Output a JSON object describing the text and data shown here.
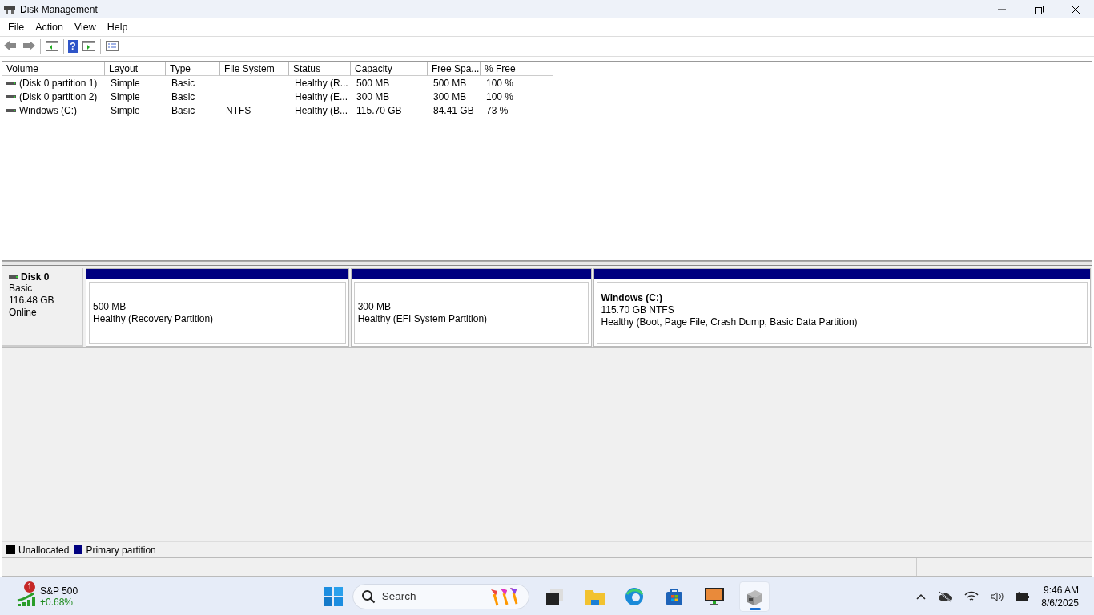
{
  "window": {
    "title": "Disk Management"
  },
  "menu": [
    "File",
    "Action",
    "View",
    "Help"
  ],
  "toolbar": [
    {
      "kind": "back"
    },
    {
      "kind": "forward"
    },
    {
      "kind": "sep"
    },
    {
      "kind": "pane"
    },
    {
      "kind": "sep"
    },
    {
      "kind": "help",
      "label": "?"
    },
    {
      "kind": "pane2"
    },
    {
      "kind": "sep"
    },
    {
      "kind": "props"
    }
  ],
  "table": {
    "columns": [
      "Volume",
      "Layout",
      "Type",
      "File System",
      "Status",
      "Capacity",
      "Free Spa...",
      "% Free"
    ],
    "rows": [
      [
        "(Disk 0 partition 1)",
        "Simple",
        "Basic",
        "",
        "Healthy (R...",
        "500 MB",
        "500 MB",
        "100 %"
      ],
      [
        "(Disk 0 partition 2)",
        "Simple",
        "Basic",
        "",
        "Healthy (E...",
        "300 MB",
        "300 MB",
        "100 %"
      ],
      [
        "Windows (C:)",
        "Simple",
        "Basic",
        "NTFS",
        "Healthy (B...",
        "115.70 GB",
        "84.41 GB",
        "73 %"
      ]
    ]
  },
  "disks": [
    {
      "name": "Disk 0",
      "type": "Basic",
      "size": "116.48 GB",
      "state": "Online",
      "partitions": [
        {
          "size": "500 MB",
          "status": "Healthy (Recovery Partition)"
        },
        {
          "size": "300 MB",
          "status": "Healthy (EFI System Partition)"
        },
        {
          "name": "Windows  (C:)",
          "size": "115.70 GB NTFS",
          "status": "Healthy (Boot, Page File, Crash Dump, Basic Data Partition)"
        }
      ]
    }
  ],
  "legend": [
    {
      "label": "Unallocated",
      "color": "#000000"
    },
    {
      "label": "Primary partition",
      "color": "#000080"
    }
  ],
  "taskbar": {
    "widget": {
      "badge": "1",
      "title": "S&P 500",
      "change": "+0.68%"
    },
    "search": {
      "placeholder": "Search"
    },
    "apps": [
      {
        "kind": "taskview",
        "selected": false
      },
      {
        "kind": "folder",
        "selected": false
      },
      {
        "kind": "edge",
        "selected": false
      },
      {
        "kind": "store",
        "selected": false
      },
      {
        "kind": "monitor",
        "selected": false
      },
      {
        "kind": "diskmgmt",
        "selected": true
      }
    ],
    "clock": {
      "time": "9:46 AM",
      "date": "8/6/2025"
    }
  }
}
